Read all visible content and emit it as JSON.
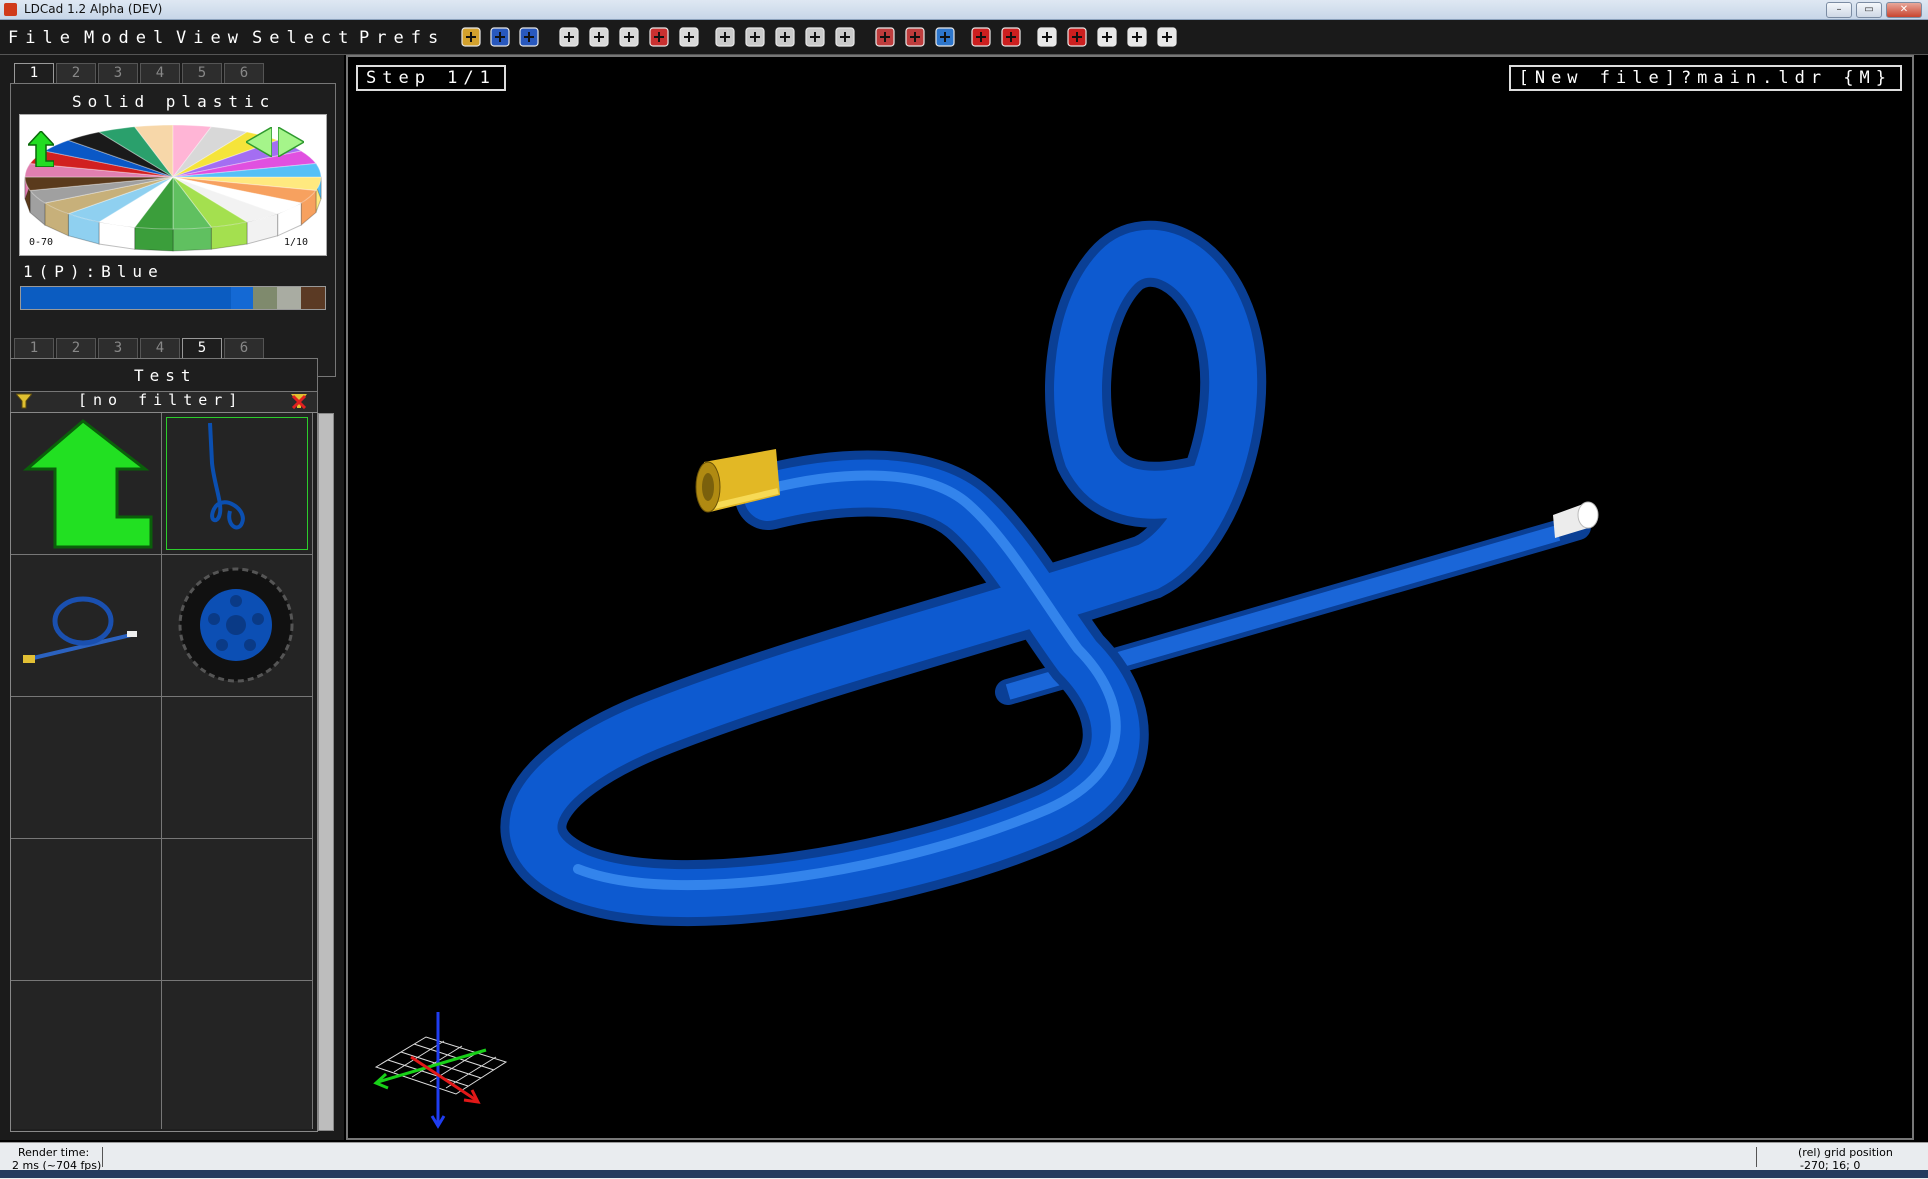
{
  "window": {
    "title": "LDCad 1.2 Alpha (DEV)"
  },
  "menu": [
    "File",
    "Model",
    "View",
    "Select",
    "Prefs"
  ],
  "toolbar": {
    "icons": [
      "open-file-icon",
      "save-icon",
      "save-all-icon",
      "undo-icon",
      "redo-icon",
      "copy-icon",
      "cut-icon",
      "paste-icon",
      "first-step-icon",
      "prev-step-icon",
      "next-step-icon",
      "last-step-icon",
      "add-step-icon",
      "snapshot-icon",
      "print-icon",
      "grid-rotation-icon",
      "heart-icon",
      "heart-remove-icon",
      "move-icon",
      "rotate-icon",
      "pan-icon",
      "select-icon",
      "grid-icon"
    ]
  },
  "color_panel": {
    "tabs": [
      "1",
      "2",
      "3",
      "4",
      "5",
      "6"
    ],
    "active_tab": "1",
    "title": "Solid plastic",
    "range_label": "0-70",
    "page_label": "1/10",
    "selected_color": "1(P):Blue",
    "swatch_colors": [
      "#0b5cc1",
      "#1469d4",
      "#7f8a6d",
      "#a9aca2",
      "#5b3a24"
    ],
    "wheel_colors": [
      "#ffe97f",
      "#f7a15f",
      "#fff",
      "#f2f2f2",
      "#a4e04f",
      "#60c060",
      "#3b9e3b",
      "#ffffff",
      "#8fd0f0",
      "#c7b07a",
      "#a0a0a0",
      "#5a3a1c",
      "#e07fb0",
      "#d12020",
      "#0a58c6",
      "#1a1a1a",
      "#2aa06c",
      "#f7d7a9",
      "#ffb5d6",
      "#d8d8d8",
      "#f5e43a",
      "#a46ef2",
      "#e050e0",
      "#55c0f7"
    ]
  },
  "parts_panel": {
    "tabs": [
      "1",
      "2",
      "3",
      "4",
      "5",
      "6"
    ],
    "active_tab": "5",
    "title": "Test",
    "filter": "[no filter]"
  },
  "viewport": {
    "step": "Step 1/1",
    "file": "[New file]?main.ldr {M}"
  },
  "status": {
    "render_label": "Render time:",
    "render_value": "2 ms (~704 fps)",
    "grid_label": "(rel) grid position",
    "grid_value": "-270; 16; 0"
  }
}
